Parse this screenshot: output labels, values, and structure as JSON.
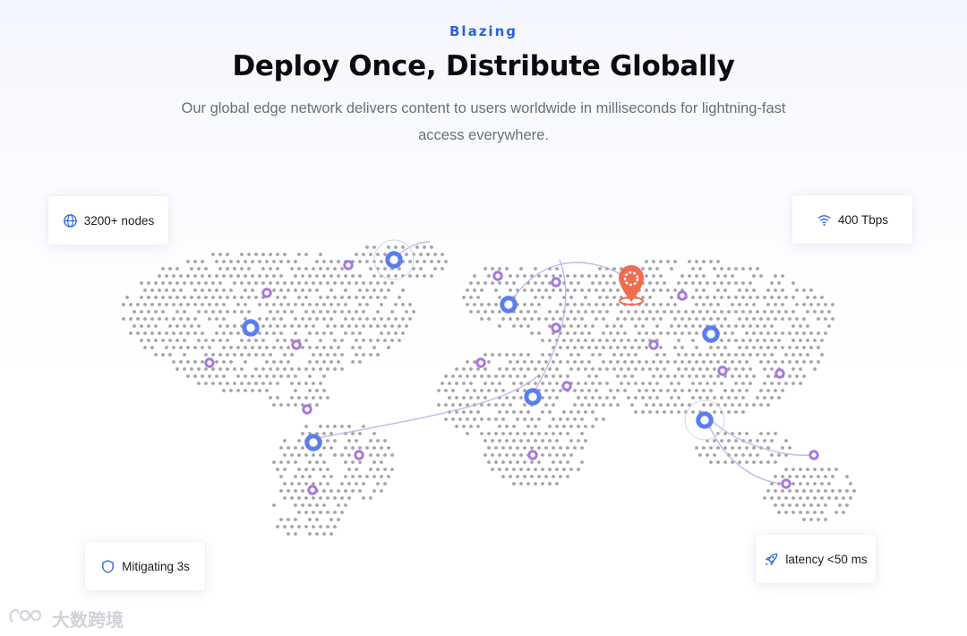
{
  "header": {
    "eyebrow": "Blazing",
    "title": "Deploy Once, Distribute Globally",
    "subtitle": "Our global edge network delivers content to users worldwide in milliseconds for lightning-fast access everywhere."
  },
  "stats": {
    "nodes": {
      "label": "3200+ nodes",
      "icon": "globe-icon"
    },
    "bandwidth": {
      "label": "400 Tbps",
      "icon": "wifi-icon"
    },
    "mitigation": {
      "label": "Mitigating 3s",
      "icon": "shield-icon"
    },
    "latency": {
      "label": "latency <50 ms",
      "icon": "rocket-icon"
    }
  },
  "map": {
    "colors": {
      "dots": "#a3a3a3",
      "major_node": "#5b7df0",
      "minor_node": "#a678e0",
      "origin_pin": "#f06b4f",
      "arc": "#b8a8e6",
      "accent": "#2a62d6"
    },
    "major_node_count": 7,
    "minor_node_count": 18,
    "origin_marker": "map-pin-icon"
  },
  "watermark": {
    "text": "大数跨境"
  }
}
